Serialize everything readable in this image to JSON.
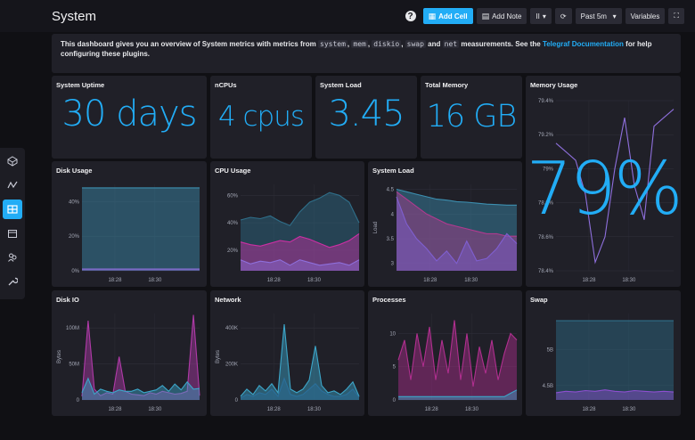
{
  "header": {
    "title": "System",
    "buttons": {
      "add_cell": "Add Cell",
      "add_note": "Add Note",
      "pause": "II",
      "time_range": "Past 5m",
      "variables": "Variables"
    }
  },
  "note": {
    "prefix": "This dashboard gives you an overview of System metrics with metrics from",
    "metrics": [
      "system",
      "mem",
      "diskio",
      "swap",
      "net"
    ],
    "sep": ",",
    "and_word": "and",
    "suffix": "measurements. See the",
    "link": "Telegraf Documentation",
    "end": "for help configuring these plugins."
  },
  "cells": {
    "uptime": {
      "title": "System Uptime",
      "value": "30 days"
    },
    "ncpus": {
      "title": "nCPUs",
      "value": "4 cpus"
    },
    "load_stat": {
      "title": "System Load",
      "value": "3.45"
    },
    "total_memory": {
      "title": "Total Memory",
      "value": "16 GB"
    },
    "memory_usage": {
      "title": "Memory Usage",
      "value": "79%"
    },
    "disk_usage": {
      "title": "Disk Usage"
    },
    "cpu_usage": {
      "title": "CPU Usage"
    },
    "system_load": {
      "title": "System Load"
    },
    "disk_io": {
      "title": "Disk IO"
    },
    "network": {
      "title": "Network"
    },
    "processes": {
      "title": "Processes"
    },
    "swap": {
      "title": "Swap"
    }
  },
  "colors": {
    "accent": "#22adf6",
    "purple": "#8e6fdc",
    "magenta": "#cc2fa3",
    "teal": "#3c8fb0"
  },
  "chart_data": [
    {
      "id": "memory_usage",
      "type": "line",
      "y_ticks": [
        "79.4%",
        "79.2%",
        "79%",
        "78.8%",
        "78.6%",
        "78.4%"
      ],
      "x_ticks": [
        "18:28",
        "18:30"
      ],
      "ylim": [
        78.4,
        79.4
      ],
      "series": [
        {
          "values": [
            79.15,
            79.1,
            79.05,
            78.85,
            78.45,
            78.6,
            79.0,
            79.3,
            78.9,
            78.7,
            79.25,
            79.3,
            79.35
          ]
        }
      ]
    },
    {
      "id": "disk_usage",
      "type": "area",
      "y_ticks": [
        "40%",
        "20%",
        "0%"
      ],
      "x_ticks": [
        "18:28",
        "18:30"
      ],
      "ylim": [
        0,
        50
      ],
      "series": [
        {
          "values": [
            48,
            48,
            48,
            48,
            48,
            48,
            48,
            48,
            48,
            48,
            48,
            48,
            48
          ]
        },
        {
          "values": [
            1,
            1,
            1,
            1,
            1,
            1,
            1,
            1,
            1,
            1,
            1,
            1,
            1
          ]
        }
      ]
    },
    {
      "id": "cpu_usage",
      "type": "area",
      "y_ticks": [
        "60%",
        "40%",
        "20%"
      ],
      "x_ticks": [
        "18:28",
        "18:30"
      ],
      "ylim": [
        5,
        68
      ],
      "series": [
        {
          "values": [
            42,
            44,
            43,
            45,
            41,
            38,
            48,
            55,
            58,
            62,
            60,
            55,
            40
          ]
        },
        {
          "values": [
            26,
            24,
            23,
            25,
            27,
            26,
            30,
            28,
            25,
            22,
            24,
            27,
            32
          ]
        },
        {
          "values": [
            13,
            10,
            12,
            11,
            13,
            9,
            13,
            11,
            9,
            10,
            11,
            9,
            13
          ]
        }
      ]
    },
    {
      "id": "system_load",
      "type": "area",
      "y_ticks": [
        "4.5",
        "4",
        "3.5",
        "3"
      ],
      "x_ticks": [
        "18:28",
        "18:30"
      ],
      "ylim": [
        2.85,
        4.6
      ],
      "ylabel": "Load",
      "series": [
        {
          "values": [
            4.5,
            4.45,
            4.4,
            4.35,
            4.3,
            4.28,
            4.25,
            4.24,
            4.22,
            4.2,
            4.19,
            4.18,
            4.18
          ]
        },
        {
          "values": [
            4.45,
            4.3,
            4.15,
            4.0,
            3.9,
            3.8,
            3.75,
            3.7,
            3.65,
            3.6,
            3.6,
            3.55,
            3.55
          ]
        },
        {
          "values": [
            4.35,
            3.8,
            3.5,
            3.3,
            3.05,
            3.25,
            3.0,
            3.45,
            3.05,
            3.1,
            3.3,
            3.6,
            3.4
          ]
        }
      ]
    },
    {
      "id": "disk_io",
      "type": "area",
      "y_ticks": [
        "100M",
        "50M",
        "0"
      ],
      "x_ticks": [
        "18:28",
        "18:30"
      ],
      "ylim": [
        0,
        120
      ],
      "ylabel": "Bytes",
      "series": [
        {
          "values": [
            5,
            110,
            15,
            6,
            10,
            8,
            60,
            12,
            8,
            7,
            6,
            10,
            8,
            12,
            10,
            8,
            9,
            12,
            118,
            6
          ]
        },
        {
          "values": [
            10,
            30,
            8,
            15,
            12,
            10,
            14,
            12,
            12,
            15,
            10,
            12,
            14,
            20,
            12,
            22,
            14,
            25,
            15,
            16
          ]
        }
      ]
    },
    {
      "id": "network",
      "type": "area",
      "y_ticks": [
        "400K",
        "200K",
        "0"
      ],
      "x_ticks": [
        "18:28",
        "18:30"
      ],
      "ylim": [
        0,
        480
      ],
      "ylabel": "Bytes",
      "series": [
        {
          "values": [
            20,
            60,
            30,
            80,
            50,
            90,
            40,
            420,
            60,
            40,
            60,
            110,
            300,
            80,
            40,
            50,
            30,
            60,
            100,
            20
          ]
        },
        {
          "values": [
            10,
            30,
            20,
            40,
            30,
            60,
            20,
            120,
            30,
            20,
            30,
            60,
            90,
            50,
            30,
            20,
            20,
            30,
            60,
            15
          ]
        }
      ]
    },
    {
      "id": "processes",
      "type": "area",
      "y_ticks": [
        "10",
        "5",
        "0"
      ],
      "x_ticks": [
        "18:28",
        "18:30"
      ],
      "ylim": [
        0,
        13
      ],
      "series": [
        {
          "values": [
            6,
            9,
            3,
            10,
            5,
            11,
            3,
            9,
            4,
            12,
            3,
            10,
            2,
            8,
            4,
            9,
            3,
            7,
            10,
            9
          ]
        },
        {
          "values": [
            0.5,
            0.5,
            0.5,
            0.5,
            0.5,
            0.5,
            0.5,
            0.5,
            0.5,
            0.5,
            0.5,
            0.5,
            0.5,
            0.5,
            0.5,
            0.5,
            0.5,
            0.5,
            1,
            1.5
          ]
        }
      ]
    },
    {
      "id": "swap",
      "type": "area",
      "y_ticks": [
        "5B",
        "4.5B"
      ],
      "x_ticks": [
        "18:28",
        "18:30"
      ],
      "ylim": [
        4.3,
        5.5
      ],
      "series": [
        {
          "values": [
            5.4,
            5.4,
            5.4,
            5.4,
            5.4,
            5.4,
            5.4,
            5.4,
            5.4,
            5.4,
            5.4,
            5.4,
            5.4
          ]
        },
        {
          "values": [
            4.4,
            4.42,
            4.41,
            4.43,
            4.42,
            4.44,
            4.42,
            4.41,
            4.43,
            4.42,
            4.41,
            4.42,
            4.41
          ]
        }
      ]
    }
  ]
}
